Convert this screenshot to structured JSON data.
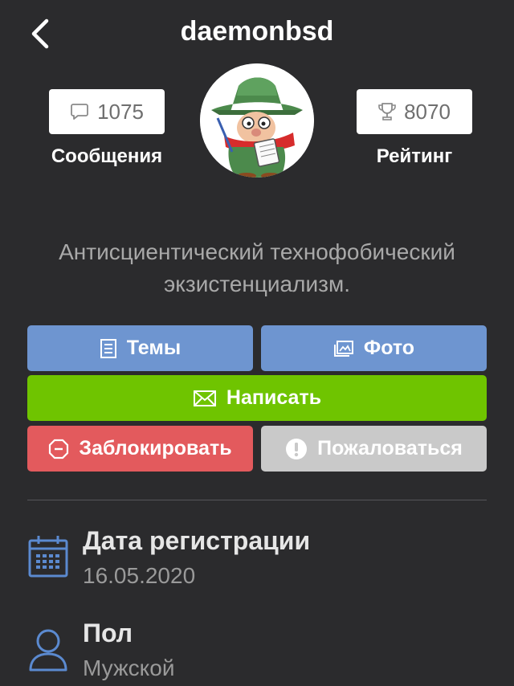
{
  "header": {
    "title": "daemonbsd"
  },
  "stats": {
    "messages": {
      "count": "1075",
      "label": "Сообщения",
      "icon": "chat-bubble-icon"
    },
    "rating": {
      "count": "8070",
      "label": "Рейтинг",
      "icon": "trophy-icon"
    }
  },
  "avatar": {
    "description": "cartoon-character-avatar"
  },
  "bio": "Антисциентический технофобический экзистенциализм.",
  "actions": {
    "topics": "Темы",
    "photo": "Фото",
    "write": "Написать",
    "block": "Заблокировать",
    "report": "Пожаловаться"
  },
  "info": {
    "registration": {
      "label": "Дата регистрации",
      "value": "16.05.2020"
    },
    "gender": {
      "label": "Пол",
      "value": "Мужской"
    }
  },
  "colors": {
    "background": "#2b2b2d",
    "blue_button": "#6e95d0",
    "green_button": "#6fc400",
    "red_button": "#e35a5d",
    "gray_button": "#c9c9c9",
    "icon_blue": "#5b8ad0"
  }
}
